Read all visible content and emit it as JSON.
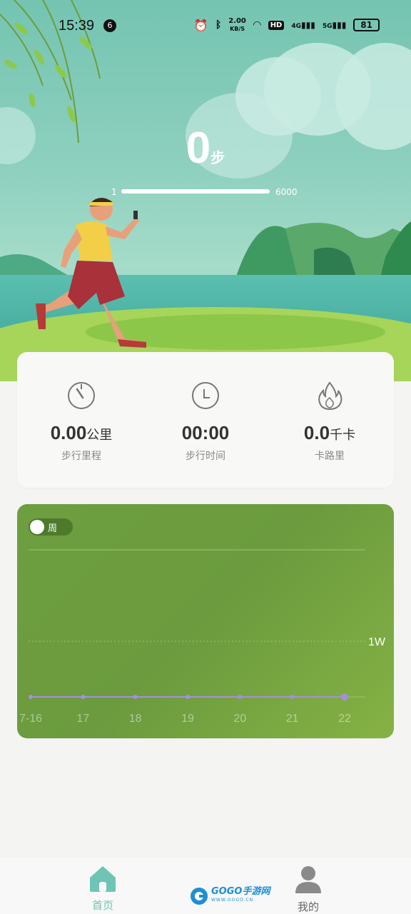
{
  "status_bar": {
    "time": "15:39",
    "notif_count": "6",
    "net_speed_value": "2.00",
    "net_speed_unit": "KB/S",
    "hd": "HD",
    "sig1": "4G",
    "sig2": "5G",
    "battery": "81"
  },
  "steps": {
    "value": "0",
    "unit": "步"
  },
  "progress": {
    "min": "1",
    "max": "6000",
    "value_fraction": 0.0
  },
  "stats": [
    {
      "value": "0.00",
      "unit": "公里",
      "label": "步行里程",
      "icon": "timer-icon"
    },
    {
      "value": "00:00",
      "unit": "",
      "label": "步行时间",
      "icon": "clock-icon"
    },
    {
      "value": "0.0",
      "unit": "千卡",
      "label": "卡路里",
      "icon": "flame-icon"
    }
  ],
  "chart_toggle": {
    "label": "周"
  },
  "chart_data": {
    "type": "line",
    "categories": [
      "7-16",
      "17",
      "18",
      "19",
      "20",
      "21",
      "22"
    ],
    "values": [
      0,
      0,
      0,
      0,
      0,
      0,
      0
    ],
    "y_ticks": [
      "1W"
    ],
    "ylim": [
      0,
      20000
    ],
    "grid": true,
    "title": "",
    "xlabel": "",
    "ylabel": ""
  },
  "tabbar": {
    "home": "首页",
    "mine": "我的"
  },
  "watermark": {
    "text": "GOGO手游网",
    "sub": "WWW.GOGO.CN"
  },
  "colors": {
    "accent": "#6ec5b5",
    "chart_bg": "#6d9e3f",
    "line": "#a58fe0"
  }
}
